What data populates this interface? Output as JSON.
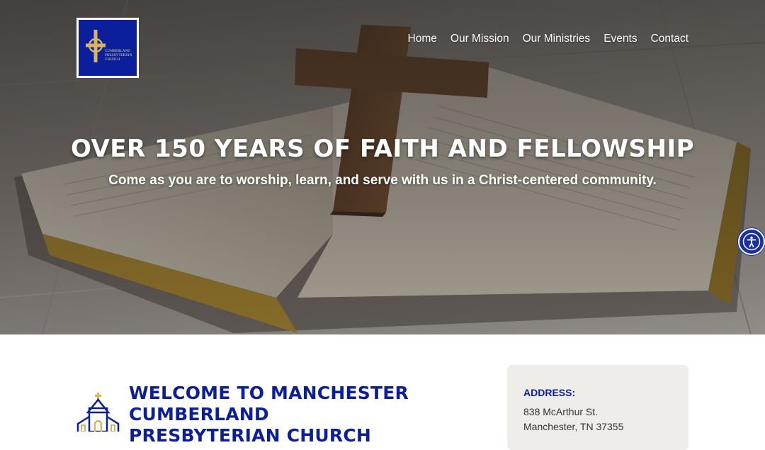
{
  "header": {
    "logo_text": "CUMBERLAND\nPRESBYTERIAN\nCHURCH",
    "nav": [
      {
        "label": "Home"
      },
      {
        "label": "Our Mission"
      },
      {
        "label": "Our Ministries"
      },
      {
        "label": "Events"
      },
      {
        "label": "Contact"
      }
    ]
  },
  "hero": {
    "title": "OVER 150 YEARS OF FAITH AND FELLOWSHIP",
    "subtitle": "Come as you are to worship, learn, and serve with us in a Christ-centered community."
  },
  "welcome": {
    "title": "WELCOME TO MANCHESTER CUMBERLAND PRESBYTERIAN CHURCH"
  },
  "address": {
    "label": "ADDRESS:",
    "line1": "838 McArthur St.",
    "line2": "Manchester, TN 37355"
  },
  "colors": {
    "brand_blue": "#0b1f9c",
    "gold": "#d9b45a",
    "card_bg": "#eeede9"
  },
  "icons": [
    "accessibility-icon",
    "church-icon",
    "celtic-cross-icon"
  ]
}
